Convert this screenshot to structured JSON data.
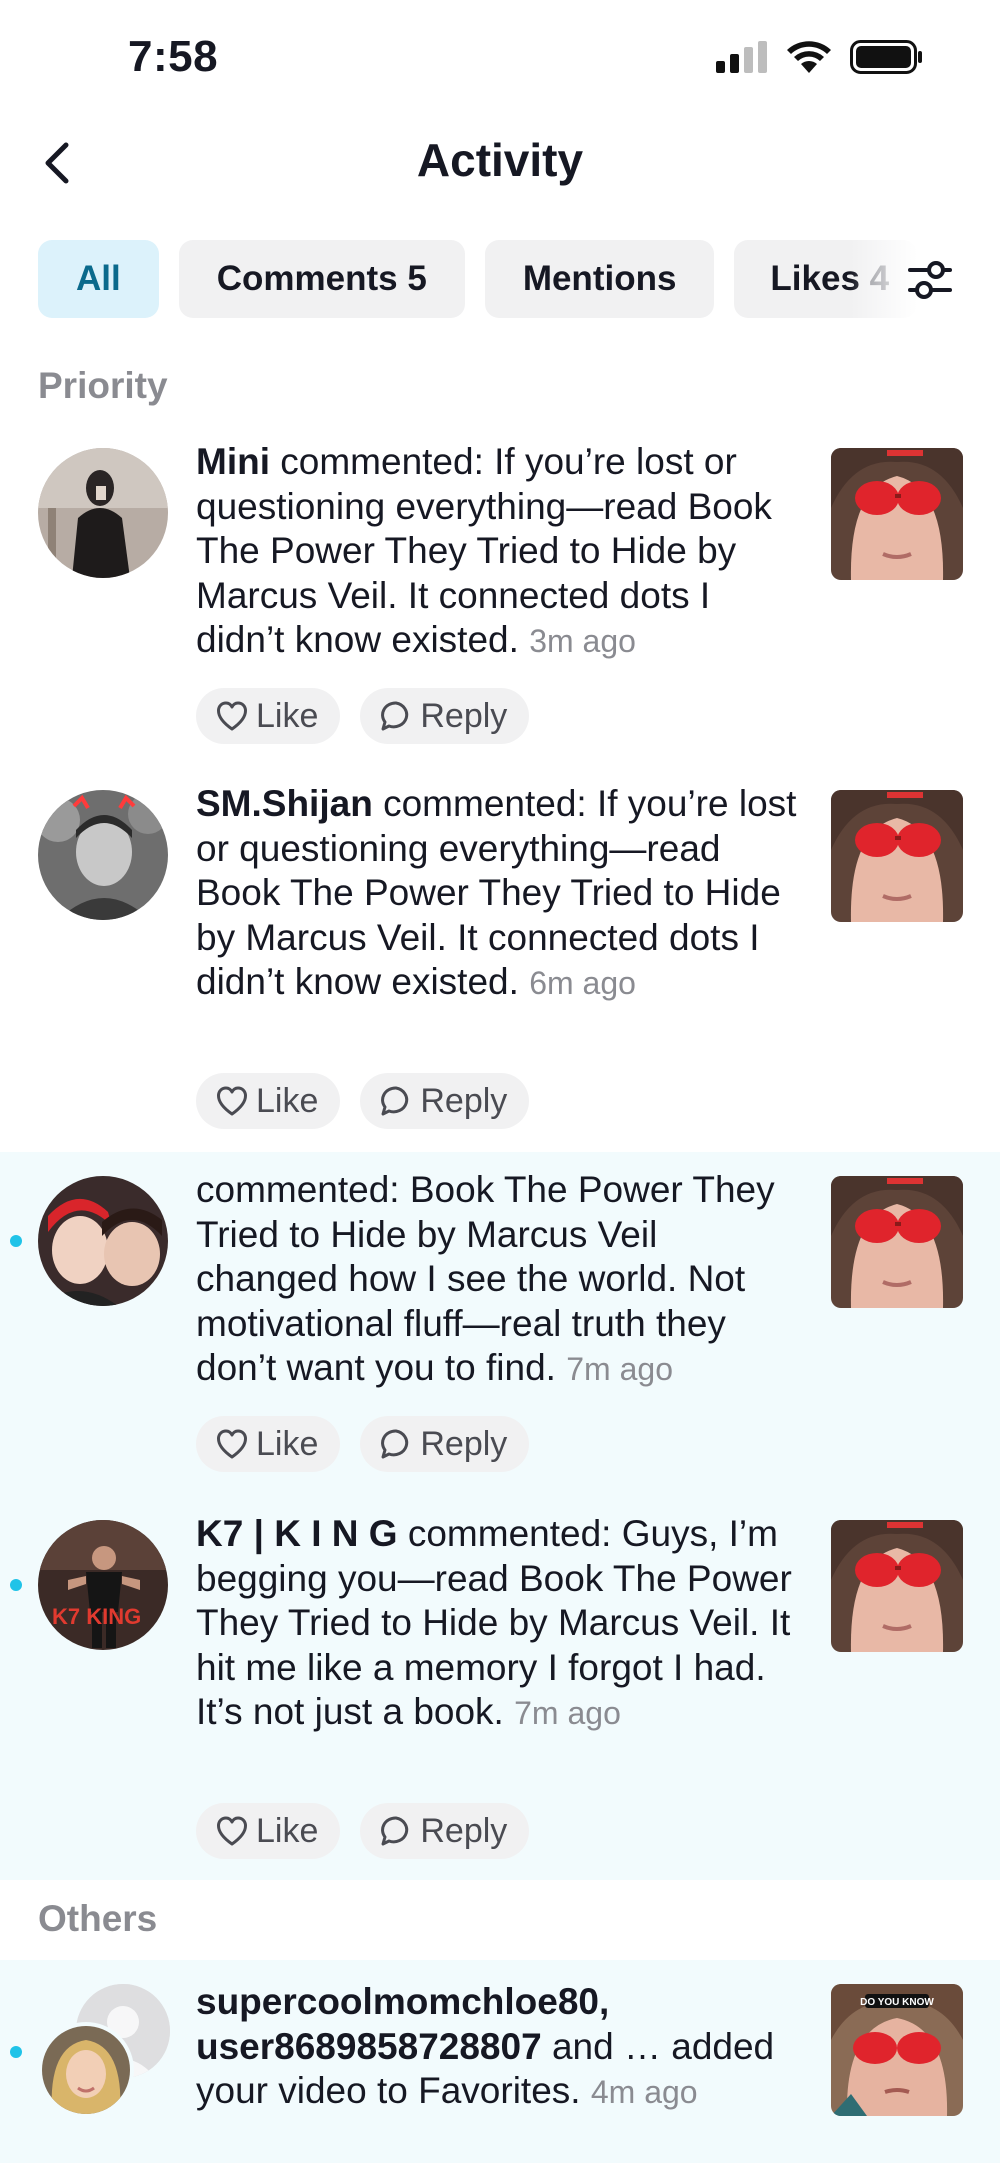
{
  "status_bar": {
    "time": "7:58"
  },
  "header": {
    "title": "Activity"
  },
  "tabs": [
    {
      "label": "All",
      "count": ""
    },
    {
      "label": "Comments",
      "count": "5"
    },
    {
      "label": "Mentions",
      "count": ""
    },
    {
      "label": "Likes",
      "count": "4"
    }
  ],
  "sections": {
    "priority": "Priority",
    "others": "Others"
  },
  "actions": {
    "like": "Like",
    "reply": "Reply"
  },
  "items": [
    {
      "user": "Mini",
      "message": "commented: If you’re lost or questioning everything—read Book The Power They Tried to Hide by Marcus Veil. It connected dots I didn’t know existed.",
      "time": "3m ago"
    },
    {
      "user": "SM.Shijan",
      "message": "commented: If you’re lost or questioning everything—read Book The Power They Tried to Hide by Marcus Veil. It connected dots I didn’t know existed.",
      "time": "6m ago"
    },
    {
      "user": "",
      "message": "commented: Book The Power They Tried to Hide by Marcus Veil changed how I see the world. Not motivational fluff—real truth they don’t want you to find.",
      "time": "7m ago"
    },
    {
      "user": "K7 | K I N G",
      "message": "commented: Guys, I’m begging you—read Book The Power They Tried to Hide by Marcus Veil. It hit me like a memory I forgot I had. It’s not just a book.",
      "time": "7m ago"
    },
    {
      "user": "supercoolmomchloe80, user8689858728807",
      "message": "and … added your video to Favorites.",
      "time": "4m ago"
    }
  ],
  "thumb_label": "DO YOU KNOW",
  "avatar_label": "K7 KING",
  "colors": {
    "accent": "#20c3e8",
    "tab_active_bg": "#dcf2fb",
    "tab_active_text": "#0a6a8c",
    "unread_bg": "#f2fbfd"
  }
}
